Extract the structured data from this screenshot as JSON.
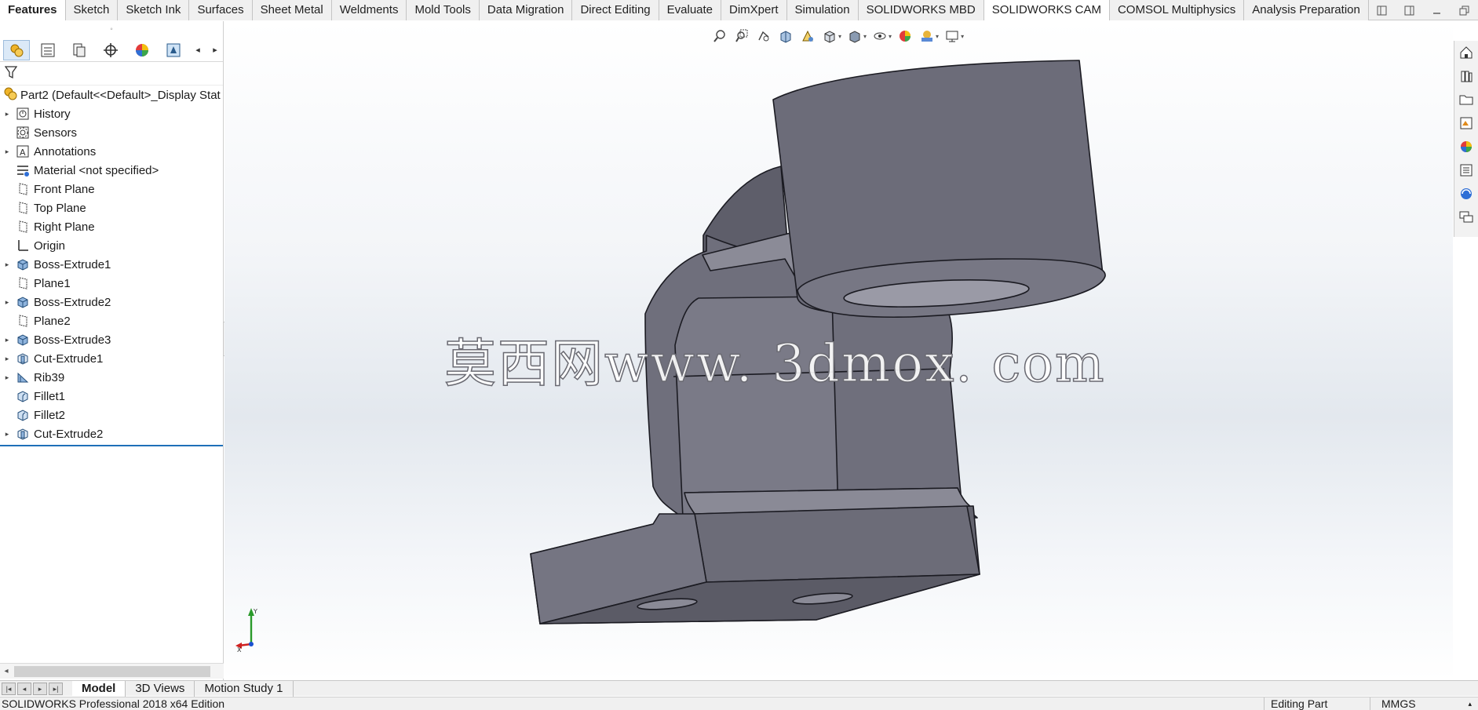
{
  "command_manager": {
    "tabs": [
      {
        "label": "Features"
      },
      {
        "label": "Sketch"
      },
      {
        "label": "Sketch Ink"
      },
      {
        "label": "Surfaces"
      },
      {
        "label": "Sheet Metal"
      },
      {
        "label": "Weldments"
      },
      {
        "label": "Mold Tools"
      },
      {
        "label": "Data Migration"
      },
      {
        "label": "Direct Editing"
      },
      {
        "label": "Evaluate"
      },
      {
        "label": "DimXpert"
      },
      {
        "label": "Simulation"
      },
      {
        "label": "SOLIDWORKS MBD"
      },
      {
        "label": "SOLIDWORKS CAM"
      },
      {
        "label": "COMSOL Multiphysics"
      },
      {
        "label": "Analysis Preparation"
      }
    ],
    "active_tab": "Features"
  },
  "feature_manager": {
    "root_label": "Part2  (Default<<Default>_Display Stat",
    "items": [
      {
        "label": "History",
        "icon": "history-icon",
        "expandable": true
      },
      {
        "label": "Sensors",
        "icon": "sensors-icon",
        "expandable": false
      },
      {
        "label": "Annotations",
        "icon": "annotations-icon",
        "expandable": true
      },
      {
        "label": "Material <not specified>",
        "icon": "material-icon",
        "expandable": false
      },
      {
        "label": "Front Plane",
        "icon": "plane-icon",
        "expandable": false
      },
      {
        "label": "Top Plane",
        "icon": "plane-icon",
        "expandable": false
      },
      {
        "label": "Right Plane",
        "icon": "plane-icon",
        "expandable": false
      },
      {
        "label": "Origin",
        "icon": "origin-icon",
        "expandable": false
      },
      {
        "label": "Boss-Extrude1",
        "icon": "boss-extrude-icon",
        "expandable": true
      },
      {
        "label": "Plane1",
        "icon": "plane-icon",
        "expandable": false
      },
      {
        "label": "Boss-Extrude2",
        "icon": "boss-extrude-icon",
        "expandable": true
      },
      {
        "label": "Plane2",
        "icon": "plane-icon",
        "expandable": false
      },
      {
        "label": "Boss-Extrude3",
        "icon": "boss-extrude-icon",
        "expandable": true
      },
      {
        "label": "Cut-Extrude1",
        "icon": "cut-extrude-icon",
        "expandable": true
      },
      {
        "label": "Rib39",
        "icon": "rib-icon",
        "expandable": true
      },
      {
        "label": "Fillet1",
        "icon": "fillet-icon",
        "expandable": false
      },
      {
        "label": "Fillet2",
        "icon": "fillet-icon",
        "expandable": false
      },
      {
        "label": "Cut-Extrude2",
        "icon": "cut-extrude-icon",
        "expandable": true
      }
    ]
  },
  "graphics": {
    "watermark": "莫西网www. 3dmox. com",
    "model_color": "#72727e"
  },
  "bottom_tabs": [
    {
      "label": "Model"
    },
    {
      "label": "3D Views"
    },
    {
      "label": "Motion Study 1"
    }
  ],
  "bottom_active": "Model",
  "status_bar": {
    "product": "SOLIDWORKS Professional 2018 x64 Edition",
    "mode": "Editing Part",
    "units": "MMGS"
  },
  "colors": {
    "accent": "#1e6fb8",
    "tab_bar": "#f0f0f0"
  }
}
